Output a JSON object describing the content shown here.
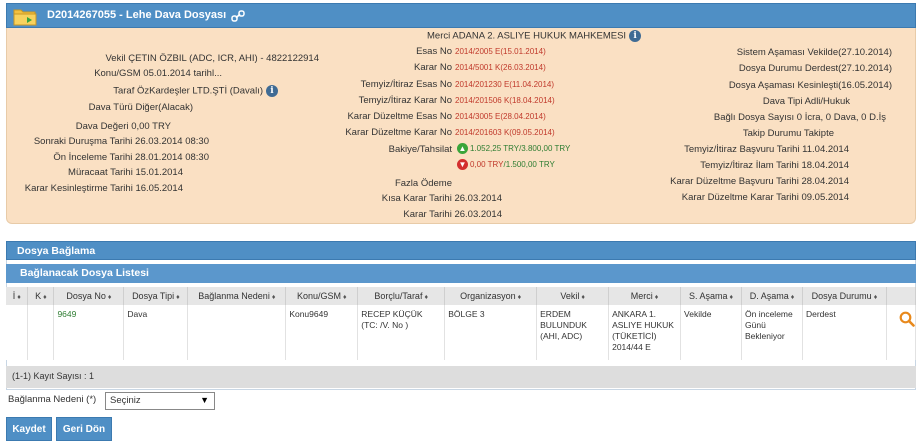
{
  "header": {
    "title": "D2014267055 - Lehe Dava Dosyası"
  },
  "left": [
    {
      "label": "Vekil",
      "value": "ÇETIN ÖZBIL (ADC, ICR, AHI) - 4822122914"
    },
    {
      "label": "Konu/GSM",
      "value": "05.01.2014 tarihl..."
    },
    {
      "label": "Taraf",
      "value": "ÖzKardeşler LTD.ŞTİ  (Davalı)"
    },
    {
      "label": "Dava Türü",
      "value": "Diğer(Alacak)"
    },
    {
      "label": "Dava Değeri",
      "value": "0,00 TRY"
    },
    {
      "label": "Sonraki Duruşma Tarihi",
      "value": "26.03.2014 08:30"
    },
    {
      "label": "Ön İnceleme Tarihi",
      "value": "28.01.2014 08:30"
    },
    {
      "label": "Müracaat Tarihi",
      "value": "15.01.2014"
    },
    {
      "label": "Karar Kesinleştirme Tarihi",
      "value": "16.05.2014"
    }
  ],
  "middle": {
    "merci_label": "Merci",
    "merci_value": "ADANA 2. ASLIYE HUKUK MAHKEMESI",
    "rows": [
      {
        "label": "Esas No",
        "value": "2014/2005 E(15.01.2014)"
      },
      {
        "label": "Karar No",
        "value": "2014/5001 K(26.03.2014)"
      },
      {
        "label": "Temyiz/İtiraz Esas No",
        "value": "2014/201230 E(11.04.2014)"
      },
      {
        "label": "Temyiz/İtiraz Karar No",
        "value": "2014/201506 K(18.04.2014)"
      },
      {
        "label": "Karar Düzeltme Esas No",
        "value": "2014/3005 E(28.04.2014)"
      },
      {
        "label": "Karar Düzeltme Karar No",
        "value": "2014/201603 K(09.05.2014)"
      }
    ],
    "bakiye_label": "Bakiye/Tahsilat",
    "bakiye_up": "1.052,25 TRY",
    "bakiye_up_total": "/3.800,00 TRY",
    "bakiye_down": "0,00 TRY",
    "bakiye_down_total": "/1.500,00 TRY",
    "fazla_odeme_label": "Fazla Ödeme",
    "kisa_karar_label": "Kısa Karar Tarihi",
    "kisa_karar_value": "26.03.2014",
    "karar_tarihi_label": "Karar Tarihi",
    "karar_tarihi_value": "26.03.2014"
  },
  "right": [
    {
      "label": "Sistem Aşaması",
      "value": "Vekilde(27.10.2014)"
    },
    {
      "label": "Dosya Durumu",
      "value": "Derdest(27.10.2014)"
    },
    {
      "label": "Dosya Aşaması",
      "value": "Kesinleşti(16.05.2014)"
    },
    {
      "label": "Dava Tipi",
      "value": "Adli/Hukuk"
    },
    {
      "label": "Bağlı Dosya Sayısı",
      "value": "0 İcra, 0 Dava, 0 D.İş"
    },
    {
      "label": "Takip Durumu",
      "value": "Takipte"
    },
    {
      "label": "Temyiz/İtiraz Başvuru Tarihi",
      "value": "11.04.2014"
    },
    {
      "label": "Temyiz/İtiraz İlam Tarihi",
      "value": "18.04.2014"
    },
    {
      "label": "Karar Düzeltme Başvuru Tarihi",
      "value": "28.04.2014"
    },
    {
      "label": "Karar Düzeltme Karar Tarihi",
      "value": "09.05.2014"
    }
  ],
  "section": {
    "title": "Dosya Bağlama",
    "subtitle": "Bağlanacak Dosya Listesi"
  },
  "table": {
    "headers": [
      "İ",
      "K",
      "Dosya No",
      "Dosya Tipi",
      "Bağlanma Nedeni",
      "Konu/GSM",
      "Borçlu/Taraf",
      "Organizasyon",
      "Vekil",
      "Merci",
      "S. Aşama",
      "D. Aşama",
      "Dosya Durumu"
    ],
    "sort_glyph": "♦",
    "row": {
      "dosya_no": "9649",
      "dosya_tipi": "Dava",
      "baglanma_nedeni": "",
      "konu": "Konu9649",
      "borclu": "RECEP KÜÇÜK (TC: /V. No )",
      "organizasyon": "BÖLGE 3",
      "vekil": "ERDEM BULUNDUK (AHI, ADC)",
      "merci": "ANKARA 1. ASLIYE HUKUK (TÜKETİCİ) 2014/44 E",
      "s_asama": "Vekilde",
      "d_asama": "Ön inceleme Günü Bekleniyor",
      "dosya_durumu": "Derdest"
    },
    "footer": "(1-1) Kayıt Sayısı : 1"
  },
  "form": {
    "label": "Bağlanma Nedeni (*)",
    "select_value": "Seçiniz"
  },
  "buttons": {
    "save": "Kaydet",
    "back": "Geri Dön"
  },
  "colors": {
    "accent": "#4f8fc5",
    "panel": "#fae0c3",
    "red": "#c0392b",
    "green": "#2e7d32"
  }
}
